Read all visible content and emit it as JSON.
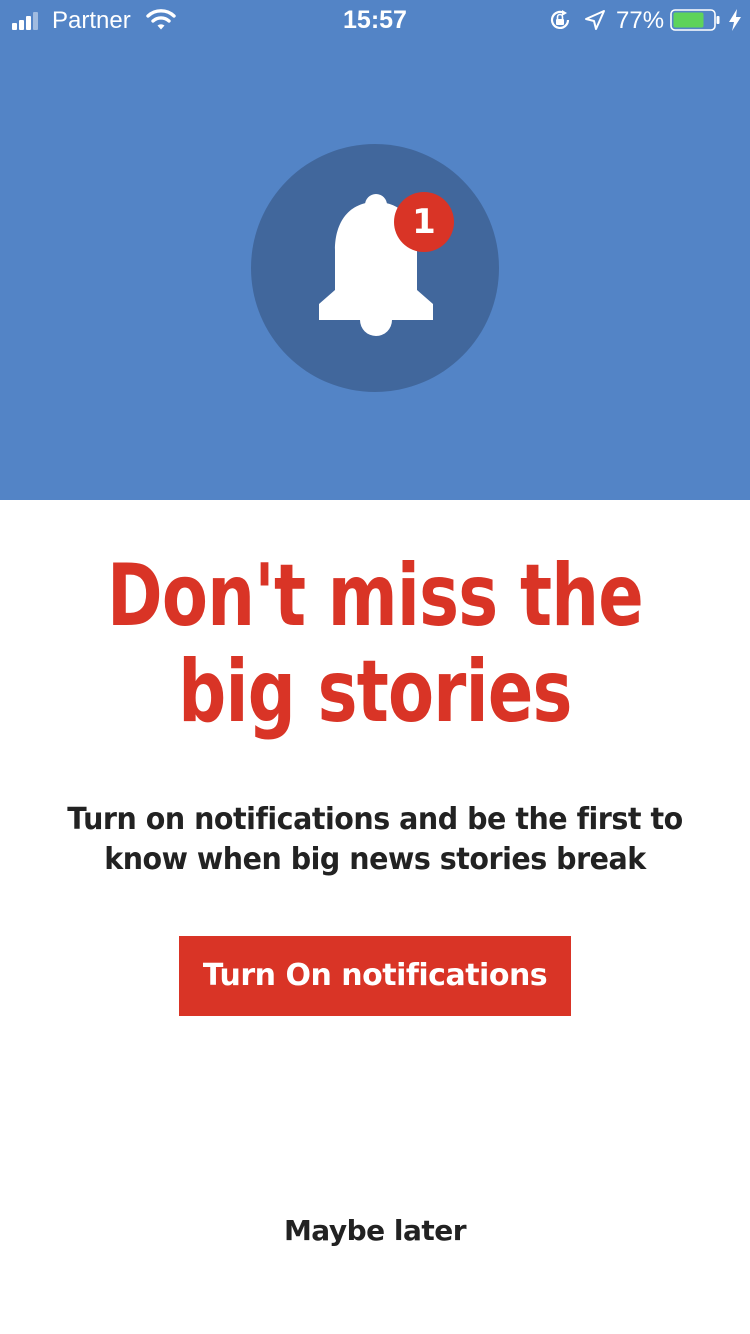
{
  "status_bar": {
    "carrier": "Partner",
    "time": "15:57",
    "battery_percent": "77%",
    "battery_level": 0.77,
    "icons": [
      "signal-icon",
      "wifi-icon",
      "rotation-lock-icon",
      "location-arrow-icon",
      "battery-icon",
      "charging-bolt-icon"
    ]
  },
  "hero": {
    "icon": "bell-icon",
    "badge_count": "1",
    "colors": {
      "background": "#5384c6",
      "circle": "#41679c",
      "badge": "#d93426"
    }
  },
  "content": {
    "headline_line1": "Don't miss the",
    "headline_line2": "big stories",
    "subtitle_line1": "Turn on notifications and be the first to",
    "subtitle_line2": "know when big news stories break",
    "cta_label": "Turn On notifications",
    "dismiss_label": "Maybe later",
    "colors": {
      "accent": "#d93426",
      "text": "#222222"
    }
  }
}
